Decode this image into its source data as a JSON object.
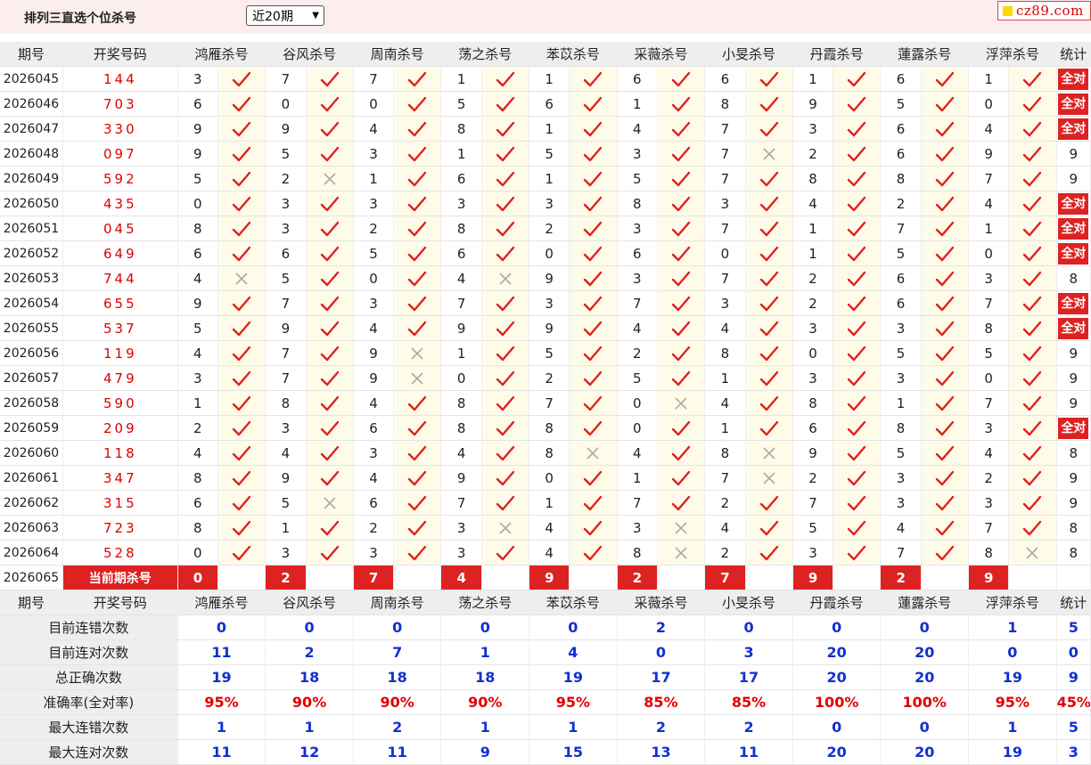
{
  "header": {
    "title": "排列三直选个位杀号",
    "period_select": "近20期",
    "site_logo": "cz89.com"
  },
  "columns": {
    "period": "期号",
    "draw": "开奖号码",
    "experts": [
      "鸿雁杀号",
      "谷风杀号",
      "周南杀号",
      "荡之杀号",
      "苯苡杀号",
      "采薇杀号",
      "小旻杀号",
      "丹霞杀号",
      "蓮露杀号",
      "浮萍杀号"
    ],
    "stats": "统计"
  },
  "rows": [
    {
      "period": "2026045",
      "draw": "144",
      "picks": [
        3,
        7,
        7,
        1,
        1,
        6,
        6,
        1,
        6,
        1
      ],
      "hits": [
        1,
        1,
        1,
        1,
        1,
        1,
        1,
        1,
        1,
        1
      ],
      "total": "全对"
    },
    {
      "period": "2026046",
      "draw": "703",
      "picks": [
        6,
        0,
        0,
        5,
        6,
        1,
        8,
        9,
        5,
        0
      ],
      "hits": [
        1,
        1,
        1,
        1,
        1,
        1,
        1,
        1,
        1,
        1
      ],
      "total": "全对"
    },
    {
      "period": "2026047",
      "draw": "330",
      "picks": [
        9,
        9,
        4,
        8,
        1,
        4,
        7,
        3,
        6,
        4
      ],
      "hits": [
        1,
        1,
        1,
        1,
        1,
        1,
        1,
        1,
        1,
        1
      ],
      "total": "全对"
    },
    {
      "period": "2026048",
      "draw": "097",
      "picks": [
        9,
        5,
        3,
        1,
        5,
        3,
        7,
        2,
        6,
        9
      ],
      "hits": [
        1,
        1,
        1,
        1,
        1,
        1,
        0,
        1,
        1,
        1
      ],
      "total": "9"
    },
    {
      "period": "2026049",
      "draw": "592",
      "picks": [
        5,
        2,
        1,
        6,
        1,
        5,
        7,
        8,
        8,
        7
      ],
      "hits": [
        1,
        0,
        1,
        1,
        1,
        1,
        1,
        1,
        1,
        1
      ],
      "total": "9"
    },
    {
      "period": "2026050",
      "draw": "435",
      "picks": [
        0,
        3,
        3,
        3,
        3,
        8,
        3,
        4,
        2,
        4
      ],
      "hits": [
        1,
        1,
        1,
        1,
        1,
        1,
        1,
        1,
        1,
        1
      ],
      "total": "全对"
    },
    {
      "period": "2026051",
      "draw": "045",
      "picks": [
        8,
        3,
        2,
        8,
        2,
        3,
        7,
        1,
        7,
        1
      ],
      "hits": [
        1,
        1,
        1,
        1,
        1,
        1,
        1,
        1,
        1,
        1
      ],
      "total": "全对"
    },
    {
      "period": "2026052",
      "draw": "649",
      "picks": [
        6,
        6,
        5,
        6,
        0,
        6,
        0,
        1,
        5,
        0
      ],
      "hits": [
        1,
        1,
        1,
        1,
        1,
        1,
        1,
        1,
        1,
        1
      ],
      "total": "全对"
    },
    {
      "period": "2026053",
      "draw": "744",
      "picks": [
        4,
        5,
        0,
        4,
        9,
        3,
        7,
        2,
        6,
        3
      ],
      "hits": [
        0,
        1,
        1,
        0,
        1,
        1,
        1,
        1,
        1,
        1
      ],
      "total": "8"
    },
    {
      "period": "2026054",
      "draw": "655",
      "picks": [
        9,
        7,
        3,
        7,
        3,
        7,
        3,
        2,
        6,
        7
      ],
      "hits": [
        1,
        1,
        1,
        1,
        1,
        1,
        1,
        1,
        1,
        1
      ],
      "total": "全对"
    },
    {
      "period": "2026055",
      "draw": "537",
      "picks": [
        5,
        9,
        4,
        9,
        9,
        4,
        4,
        3,
        3,
        8
      ],
      "hits": [
        1,
        1,
        1,
        1,
        1,
        1,
        1,
        1,
        1,
        1
      ],
      "total": "全对"
    },
    {
      "period": "2026056",
      "draw": "119",
      "picks": [
        4,
        7,
        9,
        1,
        5,
        2,
        8,
        0,
        5,
        5
      ],
      "hits": [
        1,
        1,
        0,
        1,
        1,
        1,
        1,
        1,
        1,
        1
      ],
      "total": "9"
    },
    {
      "period": "2026057",
      "draw": "479",
      "picks": [
        3,
        7,
        9,
        0,
        2,
        5,
        1,
        3,
        3,
        0
      ],
      "hits": [
        1,
        1,
        0,
        1,
        1,
        1,
        1,
        1,
        1,
        1
      ],
      "total": "9"
    },
    {
      "period": "2026058",
      "draw": "590",
      "picks": [
        1,
        8,
        4,
        8,
        7,
        0,
        4,
        8,
        1,
        7
      ],
      "hits": [
        1,
        1,
        1,
        1,
        1,
        0,
        1,
        1,
        1,
        1
      ],
      "total": "9"
    },
    {
      "period": "2026059",
      "draw": "209",
      "picks": [
        2,
        3,
        6,
        8,
        8,
        0,
        1,
        6,
        8,
        3
      ],
      "hits": [
        1,
        1,
        1,
        1,
        1,
        1,
        1,
        1,
        1,
        1
      ],
      "total": "全对"
    },
    {
      "period": "2026060",
      "draw": "118",
      "picks": [
        4,
        4,
        3,
        4,
        8,
        4,
        8,
        9,
        5,
        4
      ],
      "hits": [
        1,
        1,
        1,
        1,
        0,
        1,
        0,
        1,
        1,
        1
      ],
      "total": "8"
    },
    {
      "period": "2026061",
      "draw": "347",
      "picks": [
        8,
        9,
        4,
        9,
        0,
        1,
        7,
        2,
        3,
        2
      ],
      "hits": [
        1,
        1,
        1,
        1,
        1,
        1,
        0,
        1,
        1,
        1
      ],
      "total": "9"
    },
    {
      "period": "2026062",
      "draw": "315",
      "picks": [
        6,
        5,
        6,
        7,
        1,
        7,
        2,
        7,
        3,
        3
      ],
      "hits": [
        1,
        0,
        1,
        1,
        1,
        1,
        1,
        1,
        1,
        1
      ],
      "total": "9"
    },
    {
      "period": "2026063",
      "draw": "723",
      "picks": [
        8,
        1,
        2,
        3,
        4,
        3,
        4,
        5,
        4,
        7
      ],
      "hits": [
        1,
        1,
        1,
        0,
        1,
        0,
        1,
        1,
        1,
        1
      ],
      "total": "8"
    },
    {
      "period": "2026064",
      "draw": "528",
      "picks": [
        0,
        3,
        3,
        3,
        4,
        8,
        2,
        3,
        7,
        8
      ],
      "hits": [
        1,
        1,
        1,
        1,
        1,
        0,
        1,
        1,
        1,
        0
      ],
      "total": "8"
    }
  ],
  "current": {
    "period": "2026065",
    "label": "当前期杀号",
    "picks": [
      0,
      2,
      7,
      4,
      9,
      2,
      7,
      9,
      2,
      9
    ]
  },
  "stats": [
    {
      "label": "目前连错次数",
      "values": [
        "0",
        "0",
        "0",
        "0",
        "0",
        "2",
        "0",
        "0",
        "0",
        "1"
      ],
      "total": "5",
      "red": false
    },
    {
      "label": "目前连对次数",
      "values": [
        "11",
        "2",
        "7",
        "1",
        "4",
        "0",
        "3",
        "20",
        "20",
        "0"
      ],
      "total": "0",
      "red": false
    },
    {
      "label": "总正确次数",
      "values": [
        "19",
        "18",
        "18",
        "18",
        "19",
        "17",
        "17",
        "20",
        "20",
        "19"
      ],
      "total": "9",
      "red": false
    },
    {
      "label": "准确率(全对率)",
      "values": [
        "95%",
        "90%",
        "90%",
        "90%",
        "95%",
        "85%",
        "85%",
        "100%",
        "100%",
        "95%"
      ],
      "total": "45%",
      "red": true
    },
    {
      "label": "最大连错次数",
      "values": [
        "1",
        "1",
        "2",
        "1",
        "1",
        "2",
        "2",
        "0",
        "0",
        "1"
      ],
      "total": "5",
      "red": false
    },
    {
      "label": "最大连对次数",
      "values": [
        "11",
        "12",
        "11",
        "9",
        "15",
        "13",
        "11",
        "20",
        "20",
        "19"
      ],
      "total": "3",
      "red": false
    }
  ],
  "colors": {
    "check": "#e02020",
    "cross": "#aaaaaa",
    "accent": "#d22222",
    "stat_blue": "#1330d0"
  },
  "icons": {
    "hit": "check-icon",
    "miss": "cross-icon"
  }
}
